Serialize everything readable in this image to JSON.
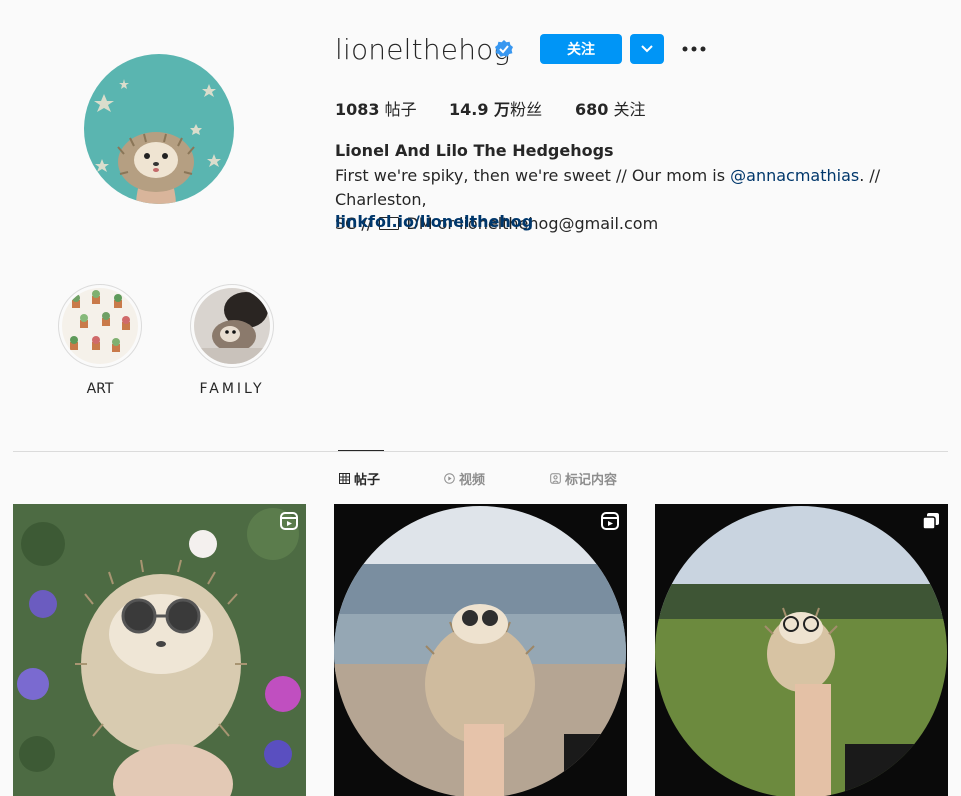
{
  "profile": {
    "username": "lionelthehog",
    "follow_label": "关注",
    "more_label": "•••"
  },
  "stats": {
    "posts_count": "1083",
    "posts_label": "帖子",
    "followers_count": "14.9 万",
    "followers_label": "粉丝",
    "following_count": "680",
    "following_label": "关注"
  },
  "bio": {
    "name": "Lionel And Lilo The Hedgehogs",
    "line1_a": "First we're spiky, then we're sweet // Our mom is ",
    "mention": "@annacmathias",
    "line1_b": ". // Charleston,",
    "line2_a": "SC // ",
    "line2_b": " DM or lionelthehog@gmail.com",
    "link": "linkfol.io/lionelthehog"
  },
  "highlights": [
    {
      "label": "ART"
    },
    {
      "label": "FAMILY"
    }
  ],
  "tabs": [
    {
      "label": "帖子",
      "icon": "grid-icon",
      "active": true
    },
    {
      "label": "视频",
      "icon": "play-circle-icon",
      "active": false
    },
    {
      "label": "标记内容",
      "icon": "tag-icon",
      "active": false
    }
  ],
  "posts": [
    {
      "badge": "reel-icon"
    },
    {
      "badge": "reel-icon"
    },
    {
      "badge": "carousel-icon"
    }
  ],
  "colors": {
    "accent": "#0095f6",
    "link": "#00376b",
    "verified": "#3897f0"
  }
}
